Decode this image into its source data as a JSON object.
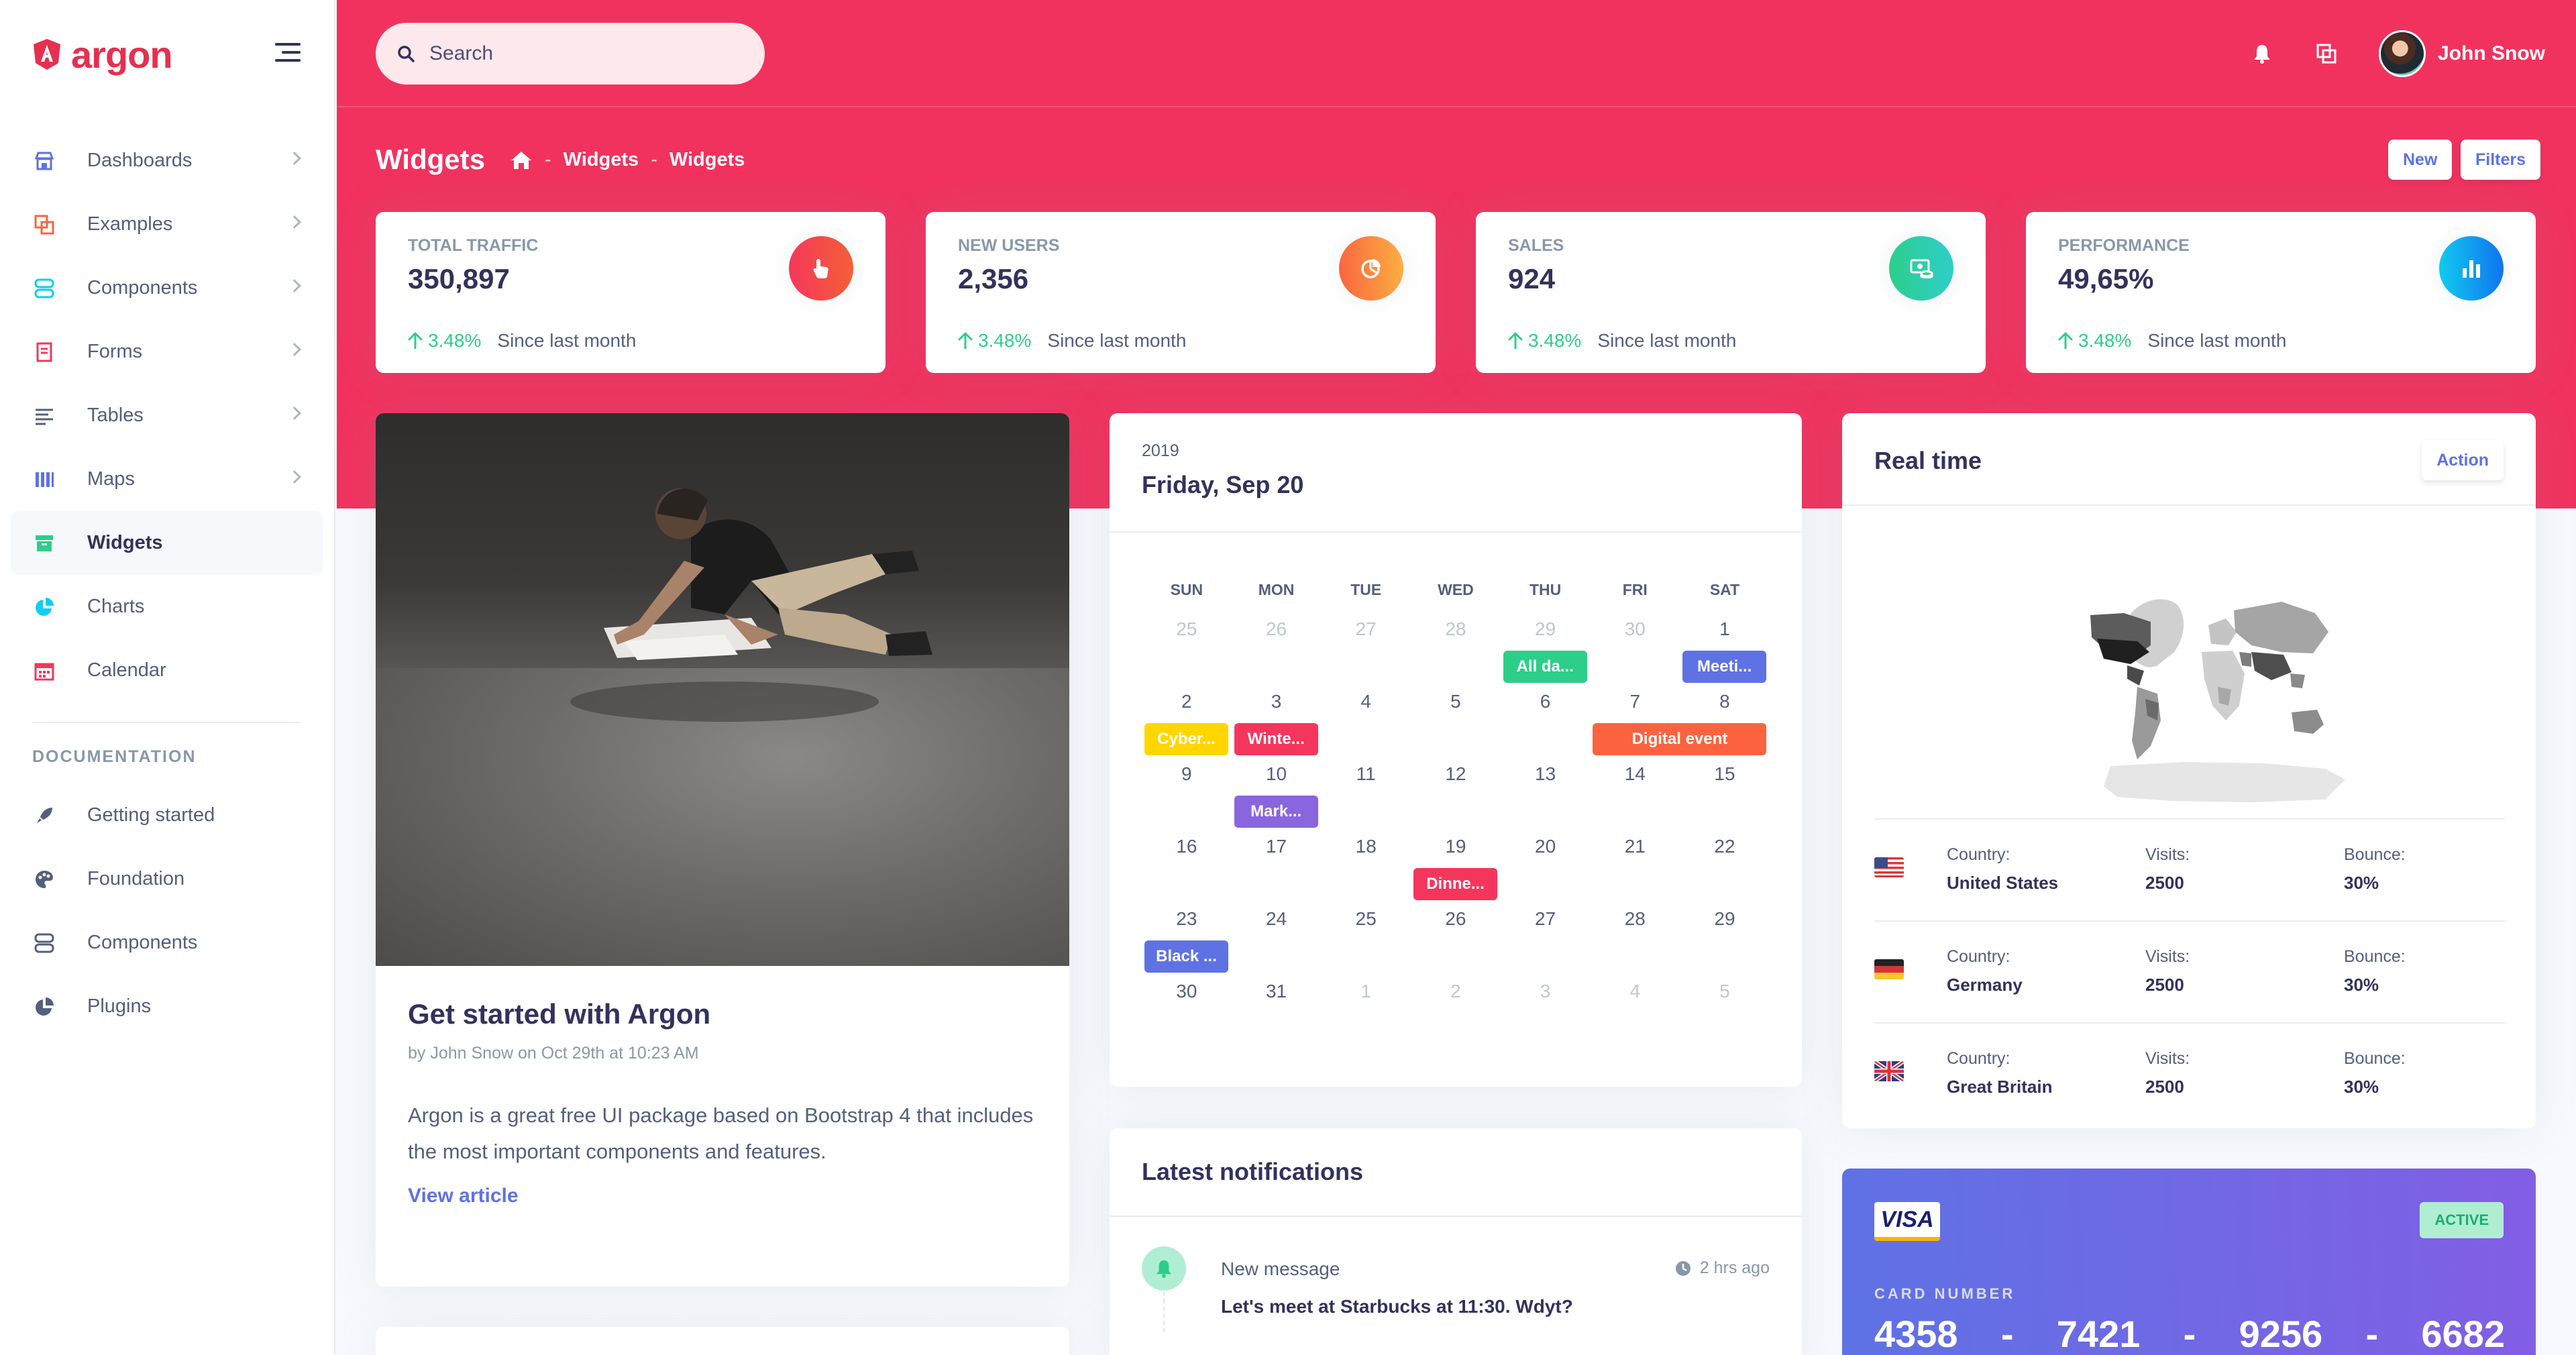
{
  "brand": {
    "name": "argon"
  },
  "sidebar": {
    "items": [
      {
        "label": "Dashboards",
        "icon": "shop-icon",
        "color": "#5e72e4"
      },
      {
        "label": "Examples",
        "icon": "ungroup-icon",
        "color": "#fb6340"
      },
      {
        "label": "Components",
        "icon": "ui-components-icon",
        "color": "#11cdef"
      },
      {
        "label": "Forms",
        "icon": "single-copy-icon",
        "color": "#f5365c"
      },
      {
        "label": "Tables",
        "icon": "align-left-icon",
        "color": "#525f7f"
      },
      {
        "label": "Maps",
        "icon": "map-big-icon",
        "color": "#5e72e4"
      },
      {
        "label": "Widgets",
        "icon": "archive-icon",
        "color": "#2dce89"
      },
      {
        "label": "Charts",
        "icon": "chart-pie-icon",
        "color": "#11cdef"
      },
      {
        "label": "Calendar",
        "icon": "calendar-icon",
        "color": "#f5365c"
      }
    ],
    "doc_heading": "DOCUMENTATION",
    "doc_items": [
      {
        "label": "Getting started",
        "icon": "spaceship-icon"
      },
      {
        "label": "Foundation",
        "icon": "palette-icon"
      },
      {
        "label": "Components",
        "icon": "ui-components-icon"
      },
      {
        "label": "Plugins",
        "icon": "chart-pie-icon"
      }
    ]
  },
  "header": {
    "search_placeholder": "Search",
    "user_name": "John Snow",
    "page_title": "Widgets",
    "breadcrumb": [
      "Widgets",
      "Widgets"
    ],
    "new_label": "New",
    "filters_label": "Filters"
  },
  "stats": [
    {
      "title": "Total traffic",
      "value": "350,897",
      "pct": "3.48%",
      "since": "Since last month",
      "icon": "active-40-icon",
      "color": "#f5365c"
    },
    {
      "title": "New users",
      "value": "2,356",
      "pct": "3.48%",
      "since": "Since last month",
      "icon": "chart-pie-icon",
      "color": "#fb6340"
    },
    {
      "title": "Sales",
      "value": "924",
      "pct": "3.48%",
      "since": "Since last month",
      "icon": "money-coins-icon",
      "color": "#2dce89"
    },
    {
      "title": "Performance",
      "value": "49,65%",
      "pct": "3.48%",
      "since": "Since last month",
      "icon": "chart-bar-icon",
      "color": "#11cdef"
    }
  ],
  "article": {
    "title": "Get started with Argon",
    "meta": "by John Snow on Oct 29th at 10:23 AM",
    "body": "Argon is a great free UI package based on Bootstrap 4 that includes the most important components and features.",
    "link": "View article"
  },
  "calendar": {
    "year": "2019",
    "date": "Friday, Sep 20",
    "weekdays": [
      "SUN",
      "MON",
      "TUE",
      "WED",
      "THU",
      "FRI",
      "SAT"
    ],
    "weeks": [
      [
        {
          "d": "25",
          "m": true
        },
        {
          "d": "26",
          "m": true
        },
        {
          "d": "27",
          "m": true
        },
        {
          "d": "28",
          "m": true
        },
        {
          "d": "29",
          "m": true
        },
        {
          "d": "30",
          "m": true
        },
        {
          "d": "1"
        }
      ],
      [
        {
          "d": "2"
        },
        {
          "d": "3"
        },
        {
          "d": "4"
        },
        {
          "d": "5"
        },
        {
          "d": "6"
        },
        {
          "d": "7"
        },
        {
          "d": "8"
        }
      ],
      [
        {
          "d": "9"
        },
        {
          "d": "10"
        },
        {
          "d": "11"
        },
        {
          "d": "12"
        },
        {
          "d": "13"
        },
        {
          "d": "14"
        },
        {
          "d": "15"
        }
      ],
      [
        {
          "d": "16"
        },
        {
          "d": "17"
        },
        {
          "d": "18"
        },
        {
          "d": "19"
        },
        {
          "d": "20"
        },
        {
          "d": "21"
        },
        {
          "d": "22"
        }
      ],
      [
        {
          "d": "23"
        },
        {
          "d": "24"
        },
        {
          "d": "25"
        },
        {
          "d": "26"
        },
        {
          "d": "27"
        },
        {
          "d": "28"
        },
        {
          "d": "29"
        }
      ],
      [
        {
          "d": "30"
        },
        {
          "d": "31"
        },
        {
          "d": "1",
          "m": true
        },
        {
          "d": "2",
          "m": true
        },
        {
          "d": "3",
          "m": true
        },
        {
          "d": "4",
          "m": true
        },
        {
          "d": "5",
          "m": true
        }
      ]
    ],
    "events": [
      {
        "week": 0,
        "day": 4,
        "span": 1,
        "label": "All da...",
        "color": "#2dce89"
      },
      {
        "week": 0,
        "day": 6,
        "span": 1,
        "label": "Meeti...",
        "color": "#5e72e4"
      },
      {
        "week": 1,
        "day": 0,
        "span": 1,
        "label": "Cyber...",
        "color": "#ffd600"
      },
      {
        "week": 1,
        "day": 1,
        "span": 1,
        "label": "Winte...",
        "color": "#f5365c"
      },
      {
        "week": 1,
        "day": 5,
        "span": 2,
        "label": "Digital event",
        "color": "#fb6340"
      },
      {
        "week": 2,
        "day": 1,
        "span": 1,
        "label": "Mark...",
        "color": "#8965e0"
      },
      {
        "week": 3,
        "day": 3,
        "span": 1,
        "label": "Dinne...",
        "color": "#f5365c"
      },
      {
        "week": 4,
        "day": 0,
        "span": 1,
        "label": "Black ...",
        "color": "#5e72e4"
      }
    ]
  },
  "notifications": {
    "title": "Latest notifications",
    "items": [
      {
        "from": "New message",
        "time": "2 hrs ago",
        "message": "Let's meet at Starbucks at 11:30. Wdyt?"
      }
    ]
  },
  "realtime": {
    "title": "Real time",
    "action_label": "Action",
    "country_label": "Country:",
    "visits_label": "Visits:",
    "bounce_label": "Bounce:",
    "rows": [
      {
        "country": "United States",
        "visits": "2500",
        "bounce": "30%",
        "flag": "us-flag-icon"
      },
      {
        "country": "Germany",
        "visits": "2500",
        "bounce": "30%",
        "flag": "de-flag-icon"
      },
      {
        "country": "Great Britain",
        "visits": "2500",
        "bounce": "30%",
        "flag": "gb-flag-icon"
      }
    ]
  },
  "credit_card": {
    "brand": "VISA",
    "status": "ACTIVE",
    "number_label": "CARD NUMBER",
    "groups": [
      "4358",
      "7421",
      "9256",
      "6682"
    ]
  },
  "colors": {
    "primary": "#5e72e4",
    "header": "#f1325f",
    "success": "#2dce89"
  }
}
